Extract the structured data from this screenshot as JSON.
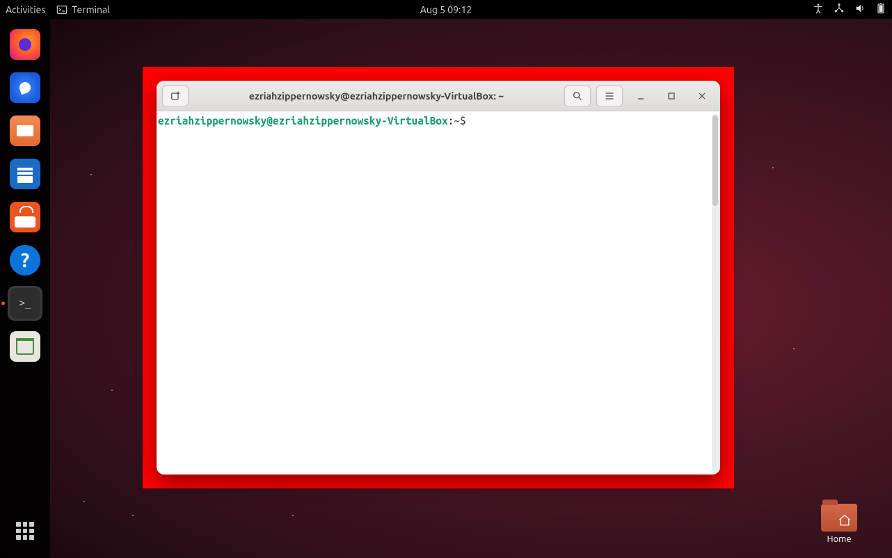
{
  "topbar": {
    "activities_label": "Activities",
    "app_label": "Terminal",
    "clock": "Aug 5  09:12"
  },
  "dock": {
    "items": [
      {
        "name": "firefox"
      },
      {
        "name": "thunderbird"
      },
      {
        "name": "files"
      },
      {
        "name": "writer"
      },
      {
        "name": "software"
      },
      {
        "name": "help",
        "glyph": "?"
      },
      {
        "name": "terminal",
        "active": true
      },
      {
        "name": "trash"
      }
    ]
  },
  "desktop": {
    "home_label": "Home"
  },
  "terminal_window": {
    "title": "ezriahzippernowsky@ezriahzippernowsky-VirtualBox: ~",
    "prompt_user_host": "ezriahzippernowsky@ezriahzippernowsky-VirtualBox",
    "prompt_sep": ":",
    "prompt_path": "~",
    "prompt_dollar": "$"
  }
}
